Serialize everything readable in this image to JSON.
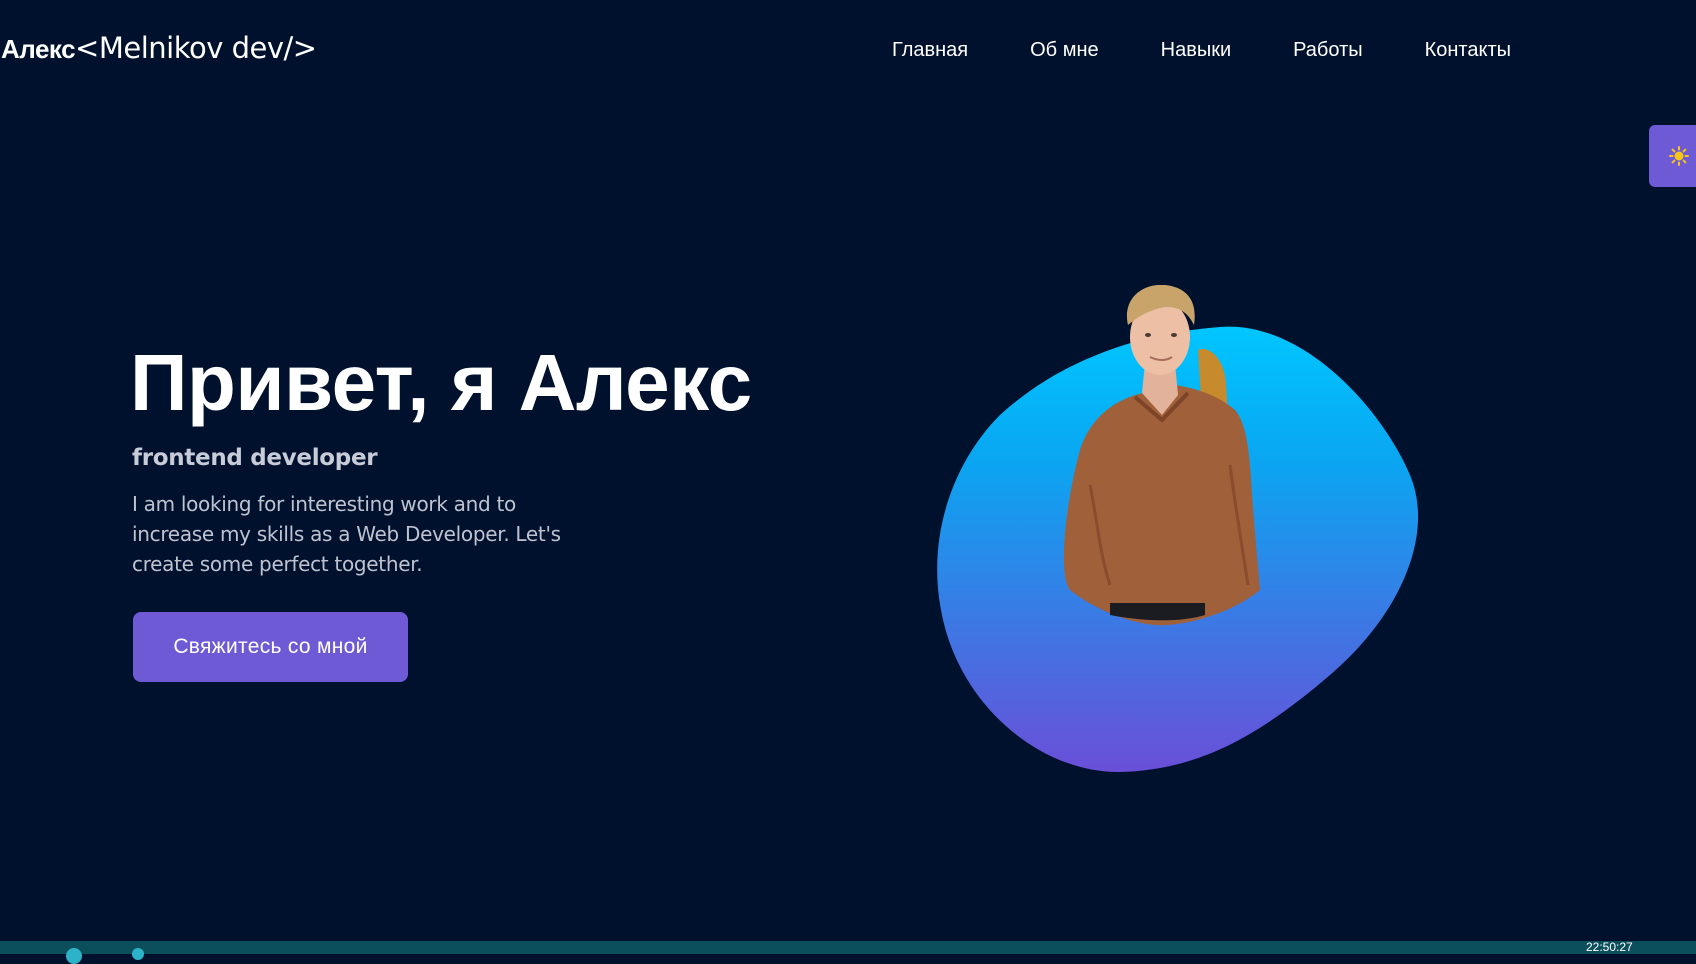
{
  "header": {
    "logo_name": "Алекс",
    "logo_tag": "<Melnikov dev/>",
    "nav": [
      {
        "label": "Главная"
      },
      {
        "label": "Об мне"
      },
      {
        "label": "Навыки"
      },
      {
        "label": "Работы"
      },
      {
        "label": "Контакты"
      }
    ]
  },
  "theme_toggle": {
    "icon": "sun-icon",
    "color": "#f5c518"
  },
  "hero": {
    "title": "Привет, я Алекс",
    "role": "frontend developer",
    "description": "I am looking for interesting work and to increase my skills as a Web Developer. Let's create some perfect together.",
    "cta_label": "Свяжитесь со мной",
    "blob_colors": [
      "#00c6ff",
      "#6a4fd8"
    ]
  },
  "taskbar": {
    "clock": "22:50:27"
  },
  "colors": {
    "background": "#00112d",
    "accent": "#6f5ad6"
  }
}
